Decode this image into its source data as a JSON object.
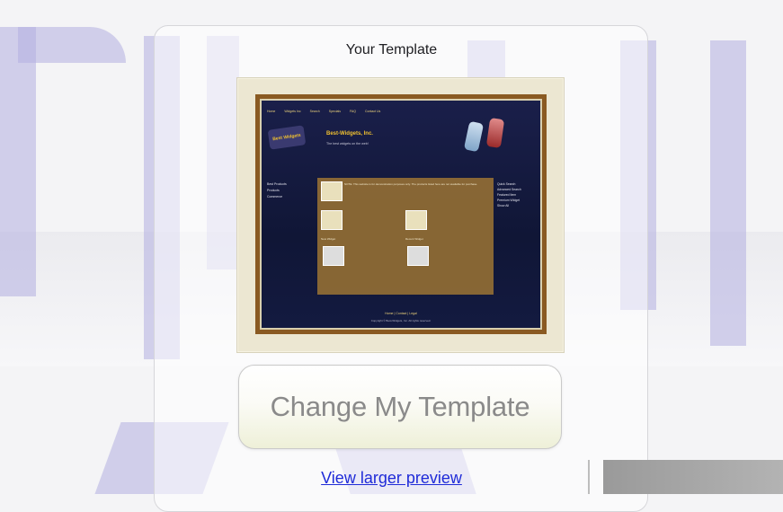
{
  "heading": "Your Template",
  "preview": {
    "site_title": "Best-Widgets, Inc.",
    "site_subtitle": "The best widgets on the web!",
    "logo_text": "Best Widgets",
    "nav": [
      "Home",
      "Widgets Inc",
      "Search",
      "Specials",
      "FAQ",
      "Contact Us"
    ],
    "left_links": [
      "Best Products",
      "Products",
      "Commerce"
    ],
    "right_col": [
      "Quick Search",
      "Advanced Search",
      "Featured Item",
      "Premium Widget",
      "Show All"
    ],
    "content_notice": "NOTE: This website is for demonstration purposes only. The products listed here are not available for purchase.",
    "product_labels": [
      "New Widget",
      "Recent Widget"
    ],
    "footer_text": "Home | Contact | Legal",
    "copyright": "Copyright © Best-Widgets, Inc. All rights reserved."
  },
  "change_button_label": "Change My Template",
  "preview_link_label": "View larger preview",
  "colors": {
    "link": "#1f2bd8",
    "watermark": "#b3aee0",
    "preview_bg": "#131a40",
    "accent": "#f0c030"
  }
}
